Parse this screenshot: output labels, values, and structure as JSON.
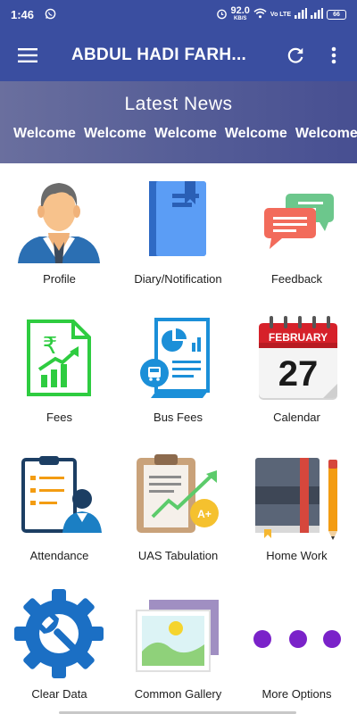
{
  "status_bar": {
    "time": "1:46",
    "speed": "92.0",
    "speed_unit": "KB/S",
    "network": "Vo LTE",
    "battery": "66"
  },
  "app_bar": {
    "title": "ABDUL HADI FARH...",
    "menu_icon": "hamburger-menu-icon",
    "refresh_icon": "refresh-icon",
    "more_icon": "more-vert-icon"
  },
  "news": {
    "title": "Latest News",
    "items": [
      "Welcome",
      "Welcome",
      "Welcome",
      "Welcome",
      "Welcome"
    ]
  },
  "menu": [
    {
      "label": "Profile",
      "icon": "profile-icon"
    },
    {
      "label": "Diary/Notification",
      "icon": "diary-icon"
    },
    {
      "label": "Feedback",
      "icon": "feedback-icon"
    },
    {
      "label": "Fees",
      "icon": "fees-icon"
    },
    {
      "label": "Bus Fees",
      "icon": "bus-fees-icon"
    },
    {
      "label": "Calendar",
      "icon": "calendar-icon",
      "month": "FEBRUARY",
      "day": "27"
    },
    {
      "label": "Attendance",
      "icon": "attendance-icon"
    },
    {
      "label": "UAS Tabulation",
      "icon": "tabulation-icon",
      "grade": "A+"
    },
    {
      "label": "Home Work",
      "icon": "homework-icon"
    },
    {
      "label": "Clear Data",
      "icon": "clear-data-icon"
    },
    {
      "label": "Common Gallery",
      "icon": "gallery-icon"
    },
    {
      "label": "More Options",
      "icon": "more-options-icon"
    }
  ],
  "colors": {
    "primary": "#3a4ea0",
    "banner": "#565e97",
    "accent_green": "#2ecc40",
    "accent_blue": "#1b7fc4"
  }
}
